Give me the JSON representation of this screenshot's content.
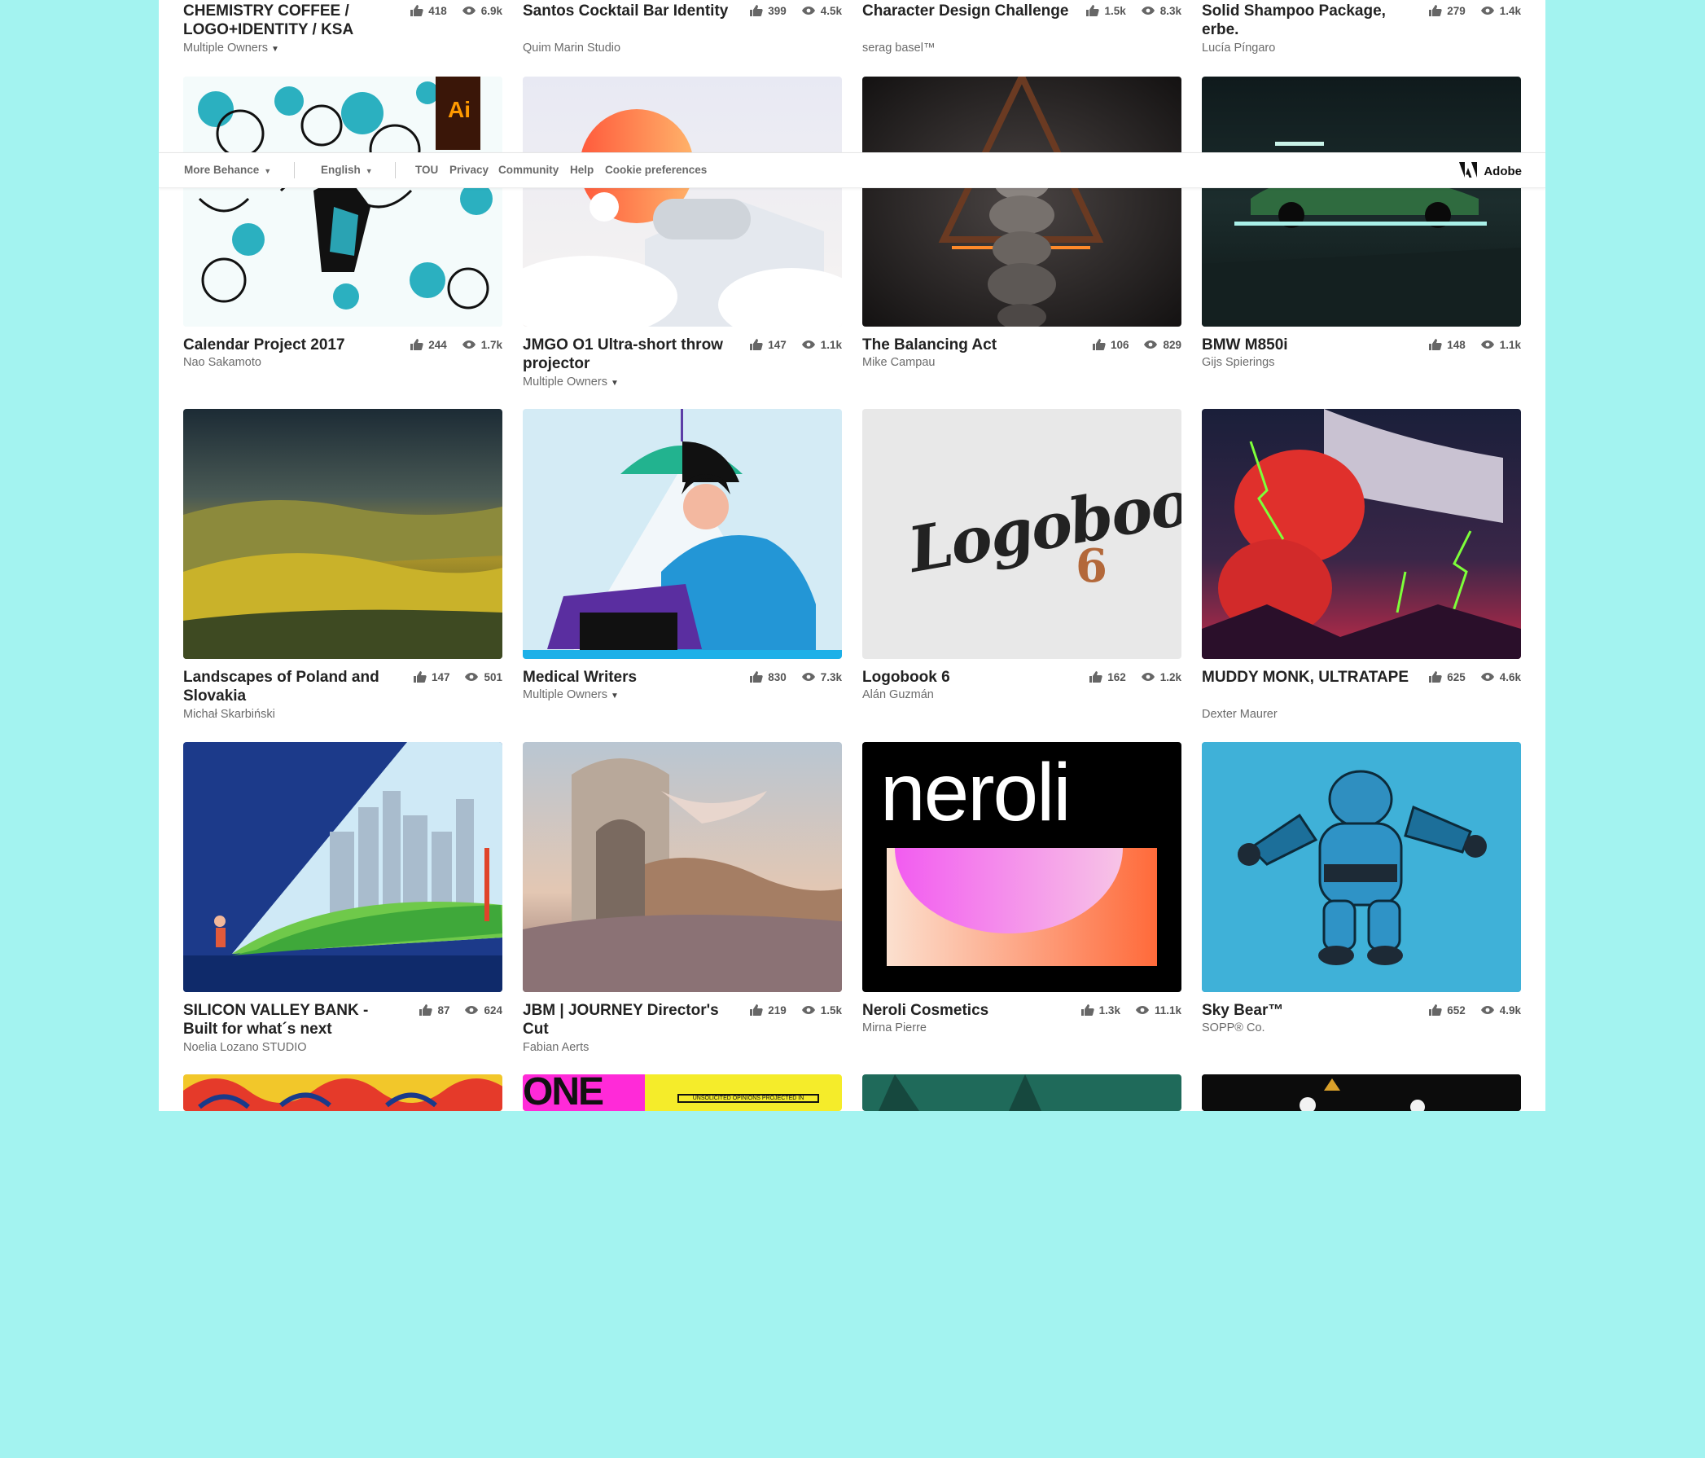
{
  "colors": {
    "background": "#a3f3f0",
    "panel": "#ffffff",
    "text": "#222222",
    "muted": "#6b6b6b"
  },
  "footer": {
    "more_behance": "More Behance",
    "language": "English",
    "links": [
      "TOU",
      "Privacy",
      "Community",
      "Help",
      "Cookie preferences"
    ],
    "brand": "Adobe"
  },
  "projects": [
    {
      "title": "CHEMISTRY COFFEE / LOGO+IDENTITY / KSA",
      "owner": "Multiple Owners",
      "likes": "418",
      "views": "6.9k"
    },
    {
      "title": "Santos Cocktail Bar Identity",
      "owner": "Quim Marin Studio",
      "likes": "399",
      "views": "4.5k"
    },
    {
      "title": "Character Design Challenge",
      "owner": "serag basel™",
      "likes": "1.5k",
      "views": "8.3k"
    },
    {
      "title": "Solid Shampoo Package, erbe.",
      "owner": "Lucía Píngaro",
      "likes": "279",
      "views": "1.4k"
    },
    {
      "title": "Calendar Project 2017",
      "owner": "Nao Sakamoto",
      "likes": "244",
      "views": "1.7k"
    },
    {
      "title": "JMGO O1 Ultra-short throw projector",
      "owner": "Multiple Owners",
      "likes": "147",
      "views": "1.1k"
    },
    {
      "title": "The Balancing Act",
      "owner": "Mike Campau",
      "likes": "106",
      "views": "829"
    },
    {
      "title": "BMW M850i",
      "owner": "Gijs Spierings",
      "likes": "148",
      "views": "1.1k"
    },
    {
      "title": "Landscapes of Poland and Slovakia",
      "owner": "Michał Skarbiński",
      "likes": "147",
      "views": "501"
    },
    {
      "title": "Medical Writers",
      "owner": "Multiple Owners",
      "likes": "830",
      "views": "7.3k"
    },
    {
      "title": "Logobook 6",
      "owner": "Alán Guzmán",
      "likes": "162",
      "views": "1.2k"
    },
    {
      "title": "MUDDY MONK, ULTRATAPE",
      "owner": "Dexter Maurer",
      "likes": "625",
      "views": "4.6k"
    },
    {
      "title": "SILICON VALLEY BANK - Built for what´s next",
      "owner": "Noelia Lozano STUDIO",
      "likes": "87",
      "views": "624"
    },
    {
      "title": "JBM | JOURNEY Director's Cut",
      "owner": "Fabian Aerts",
      "likes": "219",
      "views": "1.5k"
    },
    {
      "title": "Neroli Cosmetics",
      "owner": "Mirna Pierre",
      "likes": "1.3k",
      "views": "11.1k"
    },
    {
      "title": "Sky Bear™",
      "owner": "SOPP® Co.",
      "likes": "652",
      "views": "4.9k"
    }
  ],
  "artwork_text": {
    "ai_badge": "Ai",
    "logobook": "Logobook",
    "logobook_num": "6",
    "neroli": "neroli",
    "one": "ONE",
    "unsolicited": "UNSOLICITED OPINIONS PROJECTED IN"
  }
}
